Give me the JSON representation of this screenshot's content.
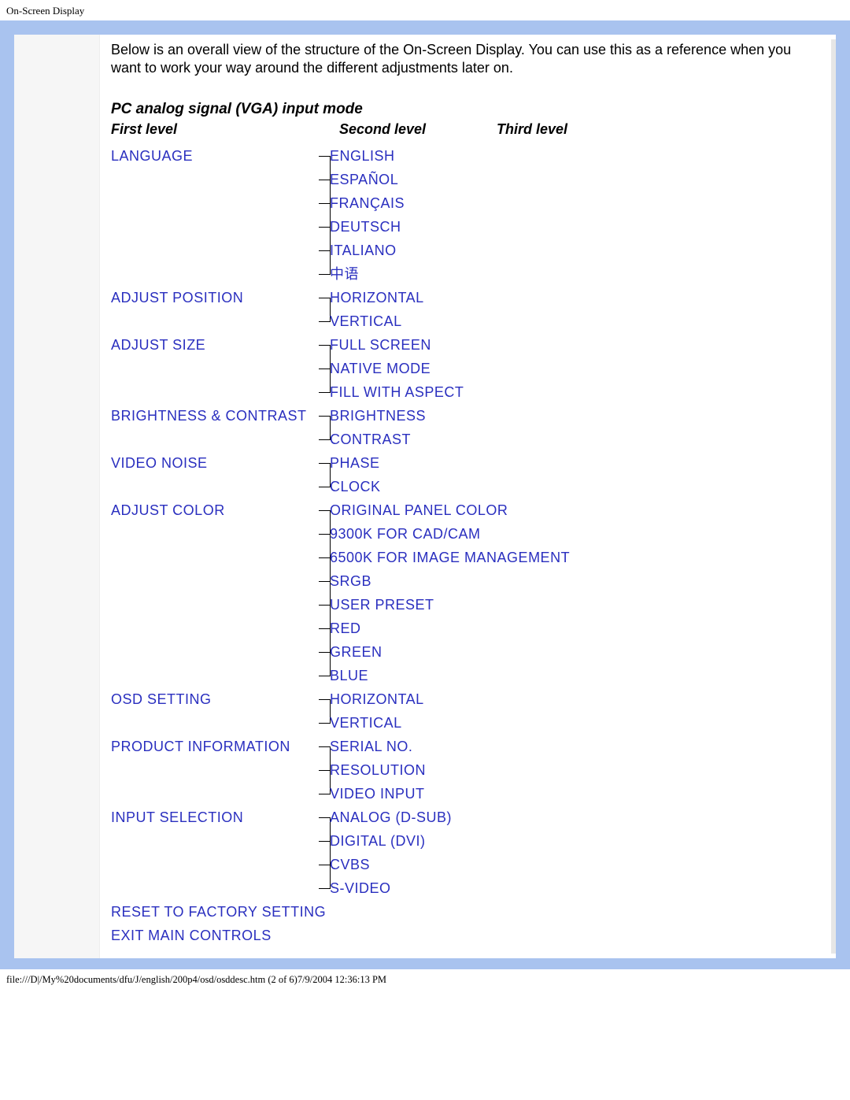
{
  "page_title": "On-Screen Display",
  "intro": "Below is an overall view of the structure of the On-Screen Display. You can use this as a reference when you want to work your way around the different adjustments later on.",
  "mode_title": "PC analog signal (VGA) input mode",
  "headers": {
    "first": "First level",
    "second": "Second level",
    "third": "Third level"
  },
  "tree": [
    {
      "label": "LANGUAGE",
      "children": [
        {
          "label": "ENGLISH"
        },
        {
          "label": "ESPAÑOL"
        },
        {
          "label": "FRANÇAIS"
        },
        {
          "label": "DEUTSCH"
        },
        {
          "label": "ITALIANO"
        },
        {
          "label": "中语"
        }
      ]
    },
    {
      "label": "ADJUST POSITION",
      "children": [
        {
          "label": "HORIZONTAL"
        },
        {
          "label": "VERTICAL"
        }
      ]
    },
    {
      "label": "ADJUST SIZE",
      "children": [
        {
          "label": "FULL SCREEN"
        },
        {
          "label": "NATIVE MODE"
        },
        {
          "label": "FILL WITH ASPECT"
        }
      ]
    },
    {
      "label": "BRIGHTNESS & CONTRAST",
      "children": [
        {
          "label": "BRIGHTNESS"
        },
        {
          "label": "CONTRAST"
        }
      ]
    },
    {
      "label": "VIDEO NOISE",
      "children": [
        {
          "label": "PHASE"
        },
        {
          "label": "CLOCK"
        }
      ]
    },
    {
      "label": "ADJUST COLOR",
      "children": [
        {
          "label": "ORIGINAL PANEL COLOR"
        },
        {
          "label": "9300K FOR CAD/CAM"
        },
        {
          "label": "6500K FOR IMAGE MANAGEMENT"
        },
        {
          "label": "sRGB"
        },
        {
          "label": "USER PRESET",
          "children": [
            {
              "label": "RED"
            },
            {
              "label": "GREEN"
            },
            {
              "label": "BLUE"
            }
          ]
        }
      ]
    },
    {
      "label": "OSD SETTING",
      "children": [
        {
          "label": "HORIZONTAL"
        },
        {
          "label": "VERTICAL"
        }
      ]
    },
    {
      "label": "PRODUCT INFORMATION",
      "children": [
        {
          "label": "SERIAL NO."
        },
        {
          "label": "RESOLUTION"
        },
        {
          "label": "VIDEO INPUT"
        }
      ]
    },
    {
      "label": "INPUT SELECTION",
      "children": [
        {
          "label": "ANALOG (D-SUB)"
        },
        {
          "label": "DIGITAL (DVI)"
        },
        {
          "label": "CVBS"
        },
        {
          "label": "S-VIDEO"
        }
      ]
    },
    {
      "label": "RESET TO FACTORY SETTING"
    },
    {
      "label": "EXIT MAIN CONTROLS"
    }
  ],
  "footer": "file:///D|/My%20documents/dfu/J/english/200p4/osd/osddesc.htm (2 of 6)7/9/2004 12:36:13 PM"
}
